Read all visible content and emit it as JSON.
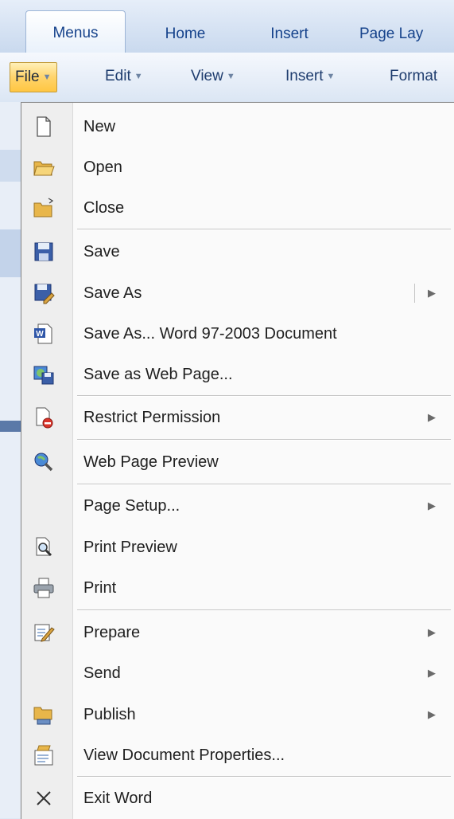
{
  "ribbon": {
    "tabs": [
      {
        "label": "Menus"
      },
      {
        "label": "Home"
      },
      {
        "label": "Insert"
      },
      {
        "label": "Page Lay"
      }
    ]
  },
  "menubar": {
    "items": [
      {
        "label": "File"
      },
      {
        "label": "Edit"
      },
      {
        "label": "View"
      },
      {
        "label": "Insert"
      },
      {
        "label": "Format"
      }
    ]
  },
  "file_menu": {
    "items": [
      {
        "label": "New",
        "icon": "new-document-icon"
      },
      {
        "label": "Open",
        "icon": "open-folder-icon"
      },
      {
        "label": "Close",
        "icon": "close-folder-icon"
      },
      {
        "label": "Save",
        "icon": "save-disk-icon"
      },
      {
        "label": "Save As",
        "icon": "save-as-icon"
      },
      {
        "label": "Save As... Word 97-2003 Document",
        "icon": "word-document-icon"
      },
      {
        "label": "Save as Web Page...",
        "icon": "save-web-page-icon"
      },
      {
        "label": "Restrict Permission",
        "icon": "restrict-permission-icon"
      },
      {
        "label": "Web Page Preview",
        "icon": "web-preview-icon"
      },
      {
        "label": "Page Setup...",
        "icon": ""
      },
      {
        "label": "Print Preview",
        "icon": "print-preview-icon"
      },
      {
        "label": "Print",
        "icon": "printer-icon"
      },
      {
        "label": "Prepare",
        "icon": "prepare-icon"
      },
      {
        "label": "Send",
        "icon": ""
      },
      {
        "label": "Publish",
        "icon": "publish-icon"
      },
      {
        "label": "View Document Properties...",
        "icon": "document-properties-icon"
      },
      {
        "label": "Exit Word",
        "icon": "exit-x-icon"
      }
    ],
    "submenu_arrow": "▶"
  }
}
